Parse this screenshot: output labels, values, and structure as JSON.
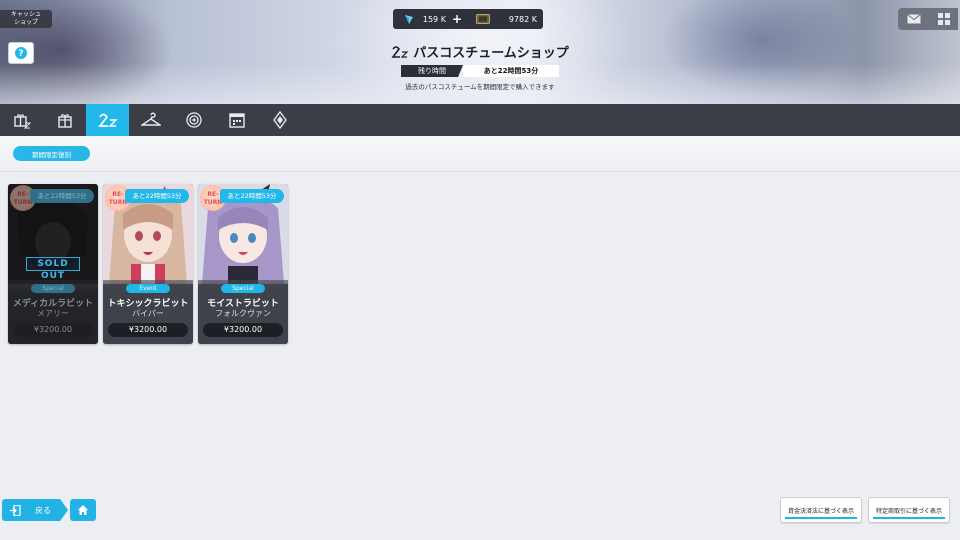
{
  "header": {
    "shop_tag": "キャッシュ\nショップ",
    "title": "パスコスチュームショップ",
    "timer_label": "残り時間",
    "timer_value": "あと22時間53分",
    "subtitle": "過去のパスコスチュームを期間限定で購入できます"
  },
  "currency": {
    "primary": "159 K",
    "secondary": "9782 K"
  },
  "tabs": [
    {
      "icon": "gift-box-icon"
    },
    {
      "icon": "present-icon"
    },
    {
      "icon": "pass-costume-icon",
      "active": true
    },
    {
      "icon": "hanger-icon"
    },
    {
      "icon": "target-icon"
    },
    {
      "icon": "calendar-icon"
    },
    {
      "icon": "diamond-icon"
    }
  ],
  "filter_chip": "期間限定復刻",
  "cards": [
    {
      "name": "メディカルラビット",
      "character": "メアリー",
      "tag": "Special",
      "price": "¥3200.00",
      "timer": "あと22時間53分",
      "badge": "RE-\nTURN",
      "sold_out": true,
      "sold_out_label": "SOLD OUT"
    },
    {
      "name": "トキシックラビット",
      "character": "バイパー",
      "tag": "Event",
      "price": "¥3200.00",
      "timer": "あと22時間53分",
      "badge": "RE-\nTURN",
      "sold_out": false
    },
    {
      "name": "モイストラビット",
      "character": "フォルクヴァン",
      "tag": "Special",
      "price": "¥3200.00",
      "timer": "あと22時間53分",
      "badge": "RE-\nTURN",
      "sold_out": false
    }
  ],
  "footer": {
    "back_label": "戻る",
    "legal_1": "資金決済法に基づく表示",
    "legal_2": "特定商取引に基づく表示"
  },
  "colors": {
    "accent": "#22b8ea",
    "tabbar": "#3b3e46",
    "card_bg": "#3f424a"
  }
}
